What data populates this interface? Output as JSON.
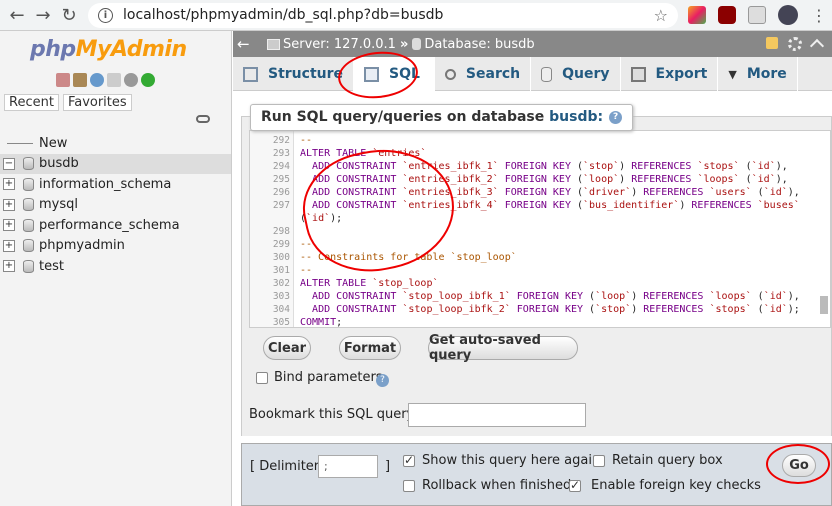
{
  "browser": {
    "url": "localhost/phpmyadmin/db_sql.php?db=busdb"
  },
  "logo": {
    "part1": "php",
    "part2": "MyAdmin"
  },
  "nav_tabs": [
    "Recent",
    "Favorites"
  ],
  "db_tree": [
    {
      "label": "New",
      "kind": "new"
    },
    {
      "label": "busdb",
      "kind": "db",
      "active": true
    },
    {
      "label": "information_schema",
      "kind": "db"
    },
    {
      "label": "mysql",
      "kind": "db"
    },
    {
      "label": "performance_schema",
      "kind": "db"
    },
    {
      "label": "phpmyadmin",
      "kind": "db"
    },
    {
      "label": "test",
      "kind": "db"
    }
  ],
  "breadcrumb": {
    "server": "Server: 127.0.0.1",
    "separator": "»",
    "database": "Database: busdb"
  },
  "tabs": [
    {
      "label": "Structure",
      "active": false
    },
    {
      "label": "SQL",
      "active": true
    },
    {
      "label": "Search",
      "active": false
    },
    {
      "label": "Query",
      "active": false
    },
    {
      "label": "Export",
      "active": false
    },
    {
      "label": "More",
      "active": false
    }
  ],
  "sql_heading": {
    "prefix": "Run SQL query/queries on database ",
    "db": "busdb:"
  },
  "editor_lines": [
    {
      "n": "292",
      "t": "--"
    },
    {
      "n": "293",
      "t": "ALTER TABLE `entries`"
    },
    {
      "n": "294",
      "t": "  ADD CONSTRAINT `entries_ibfk_1` FOREIGN KEY (`stop`) REFERENCES `stops` (`id`),"
    },
    {
      "n": "295",
      "t": "  ADD CONSTRAINT `entries_ibfk_2` FOREIGN KEY (`loop`) REFERENCES `loops` (`id`),"
    },
    {
      "n": "296",
      "t": "  ADD CONSTRAINT `entries_ibfk_3` FOREIGN KEY (`driver`) REFERENCES `users` (`id`),"
    },
    {
      "n": "297",
      "t": "  ADD CONSTRAINT `entries_ibfk_4` FOREIGN KEY (`bus_identifier`) REFERENCES `buses`"
    },
    {
      "n": "",
      "t": "(`id`);"
    },
    {
      "n": "298",
      "t": ""
    },
    {
      "n": "299",
      "t": "--"
    },
    {
      "n": "300",
      "t": "-- Constraints for table `stop_loop`"
    },
    {
      "n": "301",
      "t": "--"
    },
    {
      "n": "302",
      "t": "ALTER TABLE `stop_loop`"
    },
    {
      "n": "303",
      "t": "  ADD CONSTRAINT `stop_loop_ibfk_1` FOREIGN KEY (`loop`) REFERENCES `loops` (`id`),"
    },
    {
      "n": "304",
      "t": "  ADD CONSTRAINT `stop_loop_ibfk_2` FOREIGN KEY (`stop`) REFERENCES `stops` (`id`);"
    },
    {
      "n": "305",
      "t": "COMMIT;"
    }
  ],
  "buttons": {
    "clear": "Clear",
    "format": "Format",
    "autosaved": "Get auto-saved query",
    "go": "Go"
  },
  "bind_parameters": {
    "label": "Bind parameters",
    "checked": false
  },
  "bookmark": {
    "label": "Bookmark this SQL query:",
    "value": ""
  },
  "delimiter": {
    "open": "[ Delimiter",
    "value": ";",
    "close": "]"
  },
  "options": {
    "show_again": {
      "label": "Show this query here again",
      "checked": true
    },
    "retain_box": {
      "label": "Retain query box",
      "checked": false
    },
    "rollback": {
      "label": "Rollback when finished",
      "checked": false
    },
    "foreign_keys": {
      "label": "Enable foreign key checks",
      "checked": true
    }
  },
  "colors": {
    "accent_link": "#235a81",
    "server_bar": "#888888",
    "annotation": "#ee0000"
  }
}
